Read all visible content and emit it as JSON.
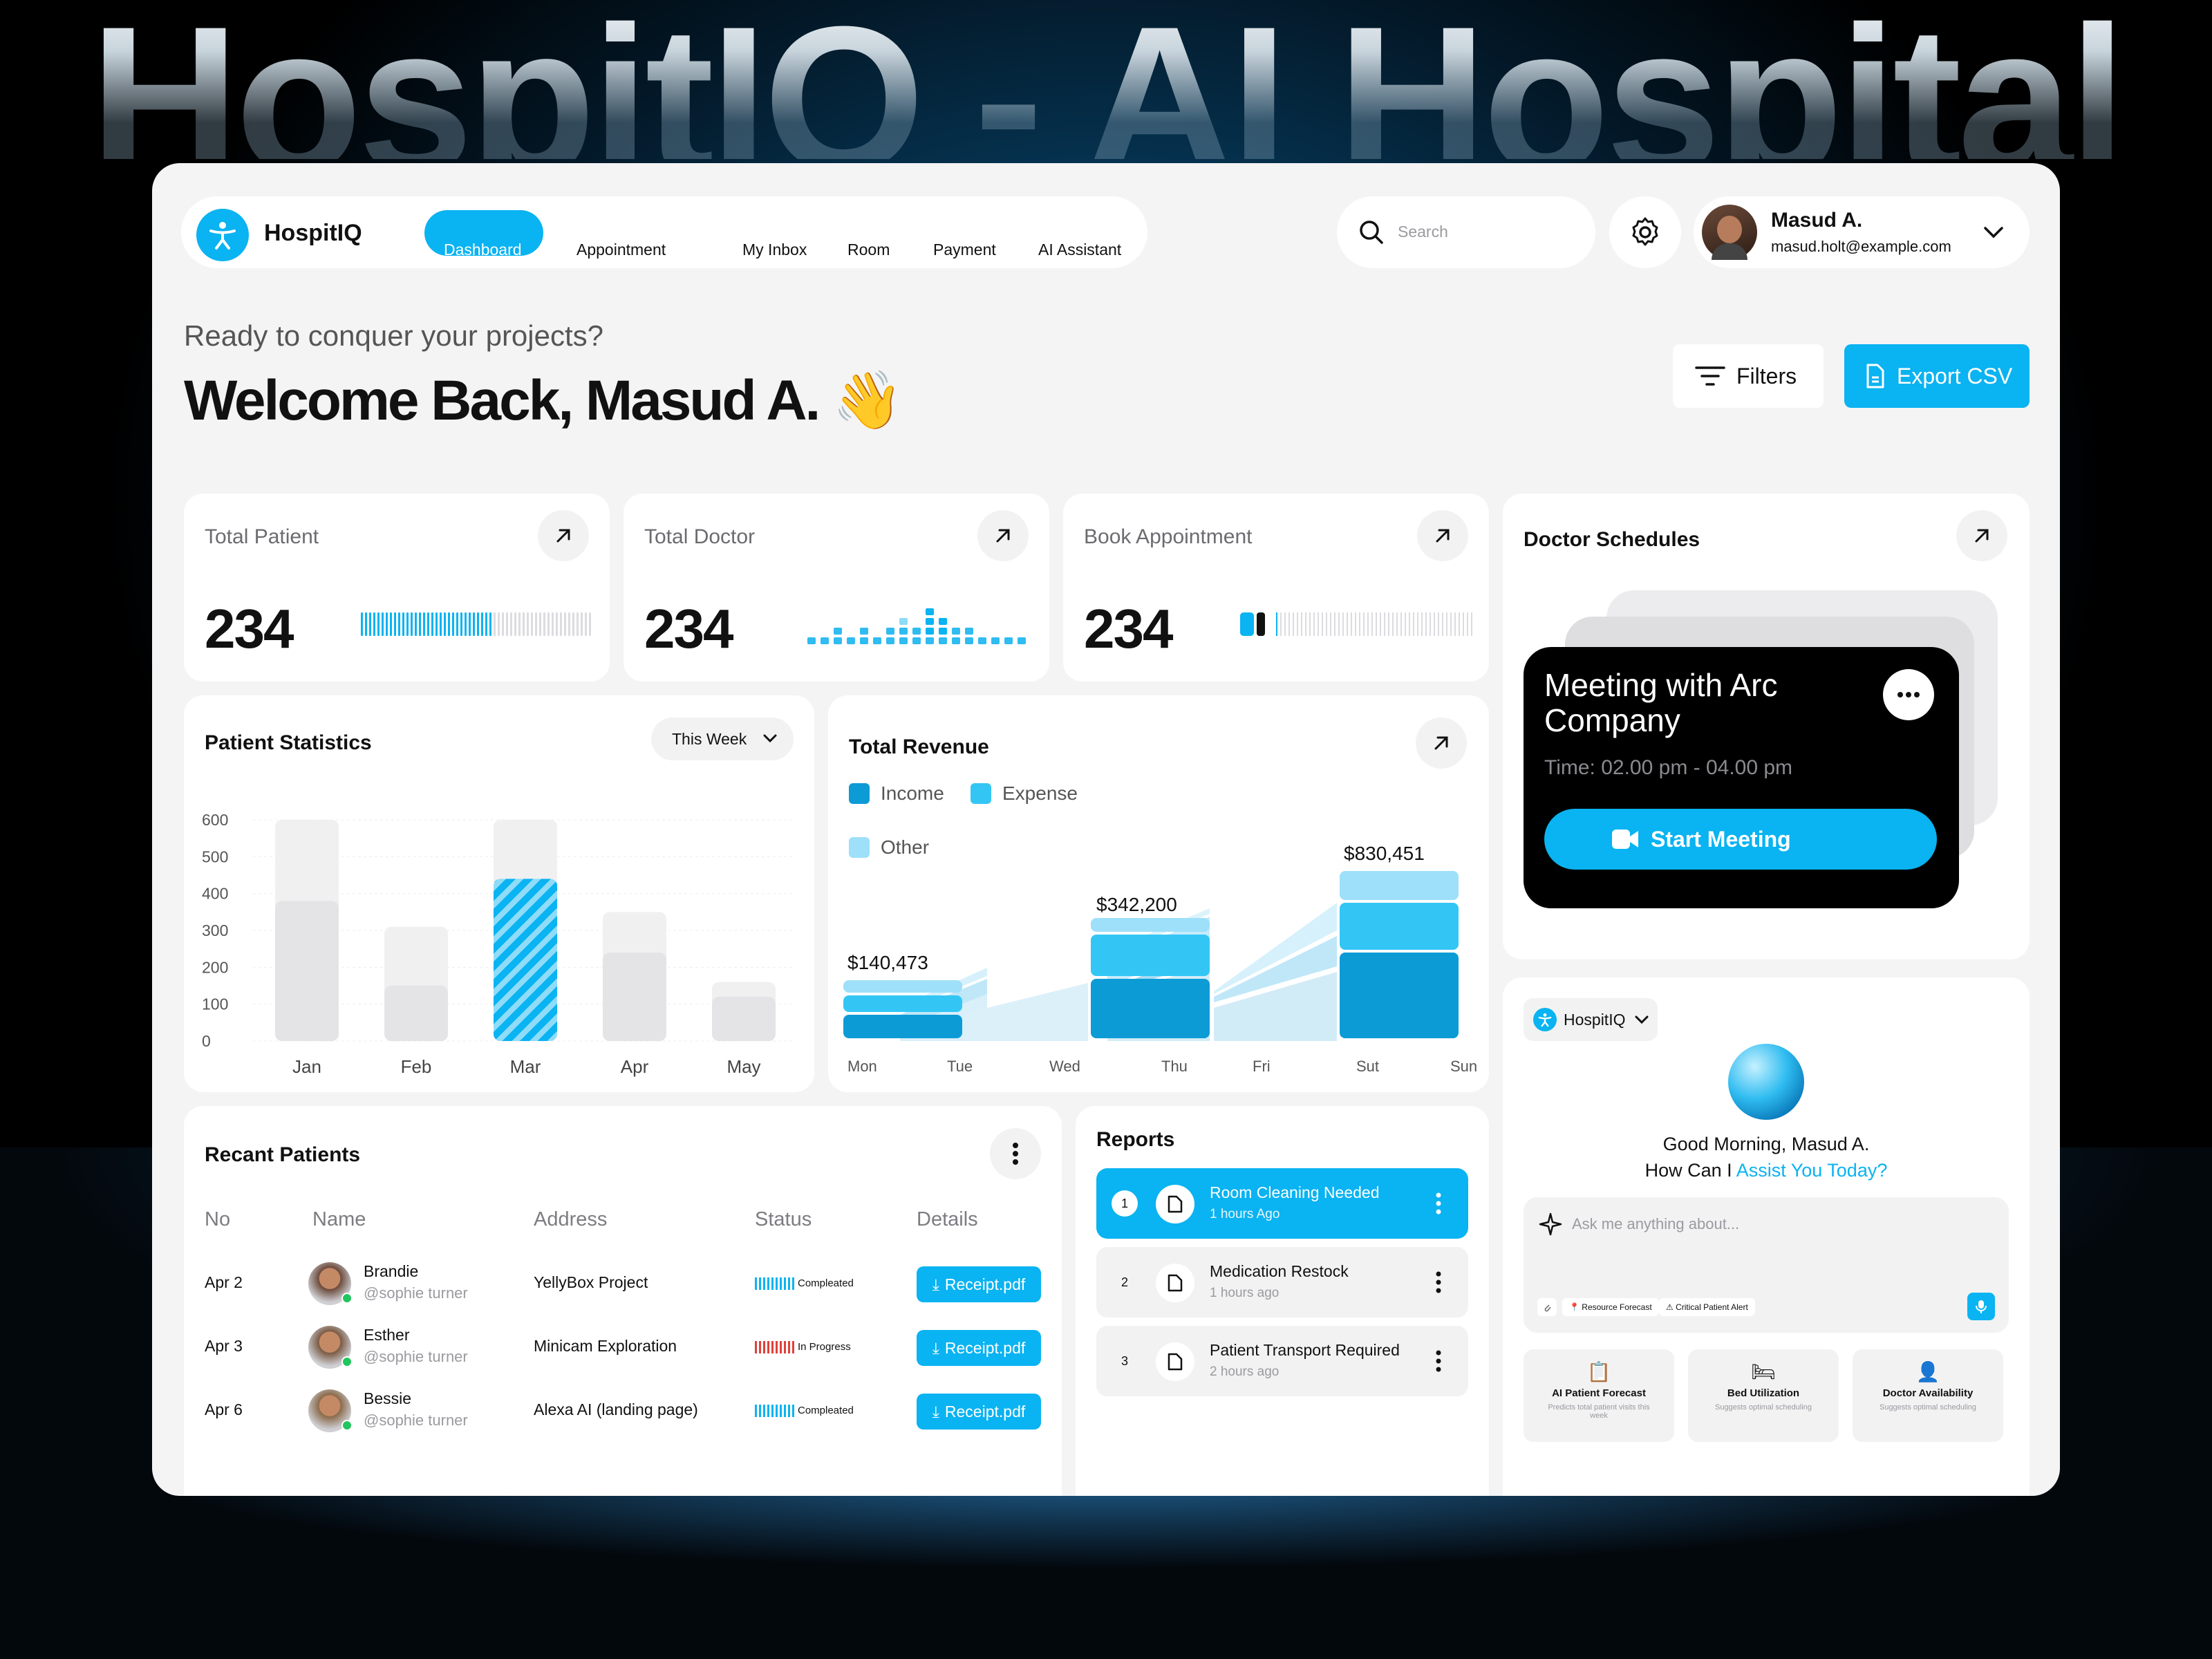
{
  "banner": {
    "title": "HospitIQ - AI Hospital"
  },
  "brand": {
    "name": "HospitIQ",
    "accent": "#0ab3f1"
  },
  "nav": {
    "items": [
      {
        "label": "Dashboard",
        "active": true
      },
      {
        "label": "Appointment"
      },
      {
        "label": "My Inbox"
      },
      {
        "label": "Room"
      },
      {
        "label": "Payment"
      },
      {
        "label": "AI Assistant"
      }
    ]
  },
  "search": {
    "placeholder": "Search"
  },
  "user": {
    "name": "Masud A.",
    "email": "masud.holt@example.com"
  },
  "greeting": {
    "subtitle": "Ready to conquer your projects?",
    "title": "Welcome Back, Masud A.",
    "emoji": "👋"
  },
  "actions": {
    "filters": "Filters",
    "export": "Export CSV"
  },
  "stats": [
    {
      "label": "Total Patient",
      "value": "234"
    },
    {
      "label": "Total Doctor",
      "value": "234"
    },
    {
      "label": "Book Appointment",
      "value": "234"
    }
  ],
  "schedule": {
    "title": "Doctor Schedules",
    "meeting_title": "Meeting with Arc Company",
    "time": "Time: 02.00 pm - 04.00 pm",
    "start": "Start Meeting"
  },
  "patient_stats": {
    "title": "Patient Statistics",
    "range": "This Week",
    "chart_data": {
      "type": "bar",
      "categories": [
        "Jan",
        "Feb",
        "Mar",
        "Apr",
        "May"
      ],
      "series": [
        {
          "values": [
            380,
            150,
            440,
            240,
            120
          ]
        },
        {
          "values": [
            600,
            310,
            600,
            350,
            160
          ]
        }
      ],
      "yticks": [
        0,
        100,
        200,
        300,
        400,
        500,
        600
      ],
      "ylim": [
        0,
        600
      ],
      "highlight": "Mar"
    }
  },
  "revenue": {
    "title": "Total Revenue",
    "legend": [
      "Income",
      "Expense",
      "Other"
    ],
    "colors": {
      "Income": "#0d9bd6",
      "Expense": "#33c6f5",
      "Other": "#9ee0f9"
    },
    "chart_data": {
      "type": "bar",
      "categories": [
        "Mon",
        "Tue",
        "Wed",
        "Thu",
        "Fri",
        "Sut",
        "Sun"
      ],
      "labels": [
        {
          "x": "Mon",
          "text": "$140,473"
        },
        {
          "x": "Thu",
          "text": "$342,200"
        },
        {
          "x": "Sut",
          "text": "$830,451"
        }
      ]
    }
  },
  "recent": {
    "title": "Recant Patients",
    "columns": [
      "No",
      "Name",
      "Address",
      "Status",
      "Details"
    ],
    "rows": [
      {
        "no": "Apr 2",
        "name": "Brandie",
        "handle": "@sophie turner",
        "address": "YellyBox Project",
        "status": "Compleated",
        "status_color": "#0ab3f1",
        "file": "Receipt.pdf"
      },
      {
        "no": "Apr 3",
        "name": "Esther",
        "handle": "@sophie turner",
        "address": "Minicam Exploration",
        "status": "In Progress",
        "status_color": "#e0403a",
        "file": "Receipt.pdf"
      },
      {
        "no": "Apr 6",
        "name": "Bessie",
        "handle": "@sophie turner",
        "address": "Alexa AI (landing page)",
        "status": "Compleated",
        "status_color": "#0ab3f1",
        "file": "Receipt.pdf"
      }
    ]
  },
  "reports": {
    "title": "Reports",
    "items": [
      {
        "n": "1",
        "title": "Room Cleaning Needed",
        "time": "1 hours Ago",
        "active": true
      },
      {
        "n": "2",
        "title": "Medication Restock",
        "time": "1 hours ago"
      },
      {
        "n": "3",
        "title": "Patient Transport Required",
        "time": "2 hours ago"
      }
    ]
  },
  "assistant": {
    "brand": "HospitIQ",
    "greet": "Good Morning, Masud A.",
    "ask_prefix": "How Can I ",
    "ask_highlight": "Assist You Today?",
    "placeholder": "Ask me anything about...",
    "chips": [
      "Resource Forecast",
      "Critical Patient Alert"
    ],
    "tools": [
      {
        "title": "AI Patient Forecast",
        "desc": "Predicts total patient visits this week"
      },
      {
        "title": "Bed Utilization",
        "desc": "Suggests optimal scheduling"
      },
      {
        "title": "Doctor Availability",
        "desc": "Suggests optimal scheduling"
      }
    ]
  }
}
